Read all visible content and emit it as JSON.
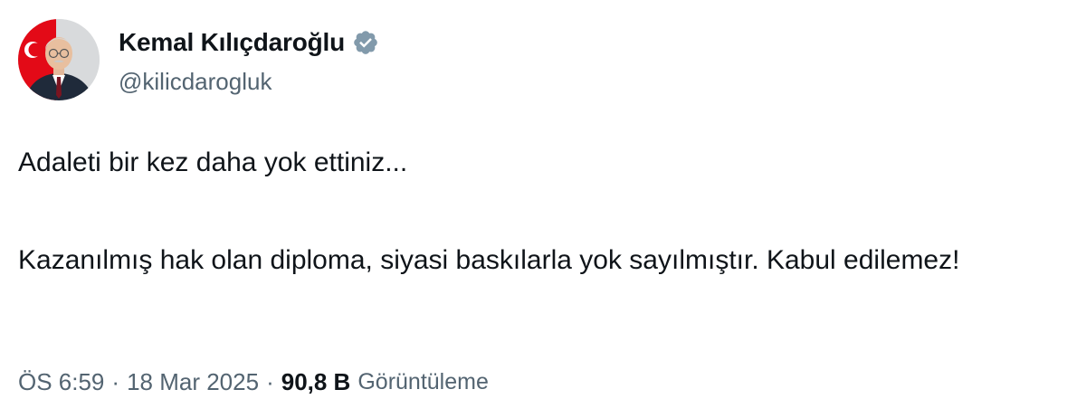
{
  "tweet": {
    "author": {
      "display_name": "Kemal Kılıçdaroğlu",
      "handle": "@kilicdarogluk",
      "verified": true
    },
    "text_paragraphs": [
      "Adaleti bir kez daha yok ettiniz...",
      "Kazanılmış hak olan diploma, siyasi baskılarla yok sayılmıştır. Kabul edilemez!"
    ],
    "meta": {
      "time": "ÖS 6:59",
      "separator": "·",
      "date": "18 Mar 2025",
      "views_count": "90,8 B",
      "views_label": "Görüntüleme"
    }
  },
  "colors": {
    "text_primary": "#0f1419",
    "text_secondary": "#536471",
    "badge": "#829aab",
    "avatar_background_flag": "#e30a17"
  },
  "icons": {
    "verified_badge": "verified-badge-icon",
    "avatar": "profile-photo"
  }
}
